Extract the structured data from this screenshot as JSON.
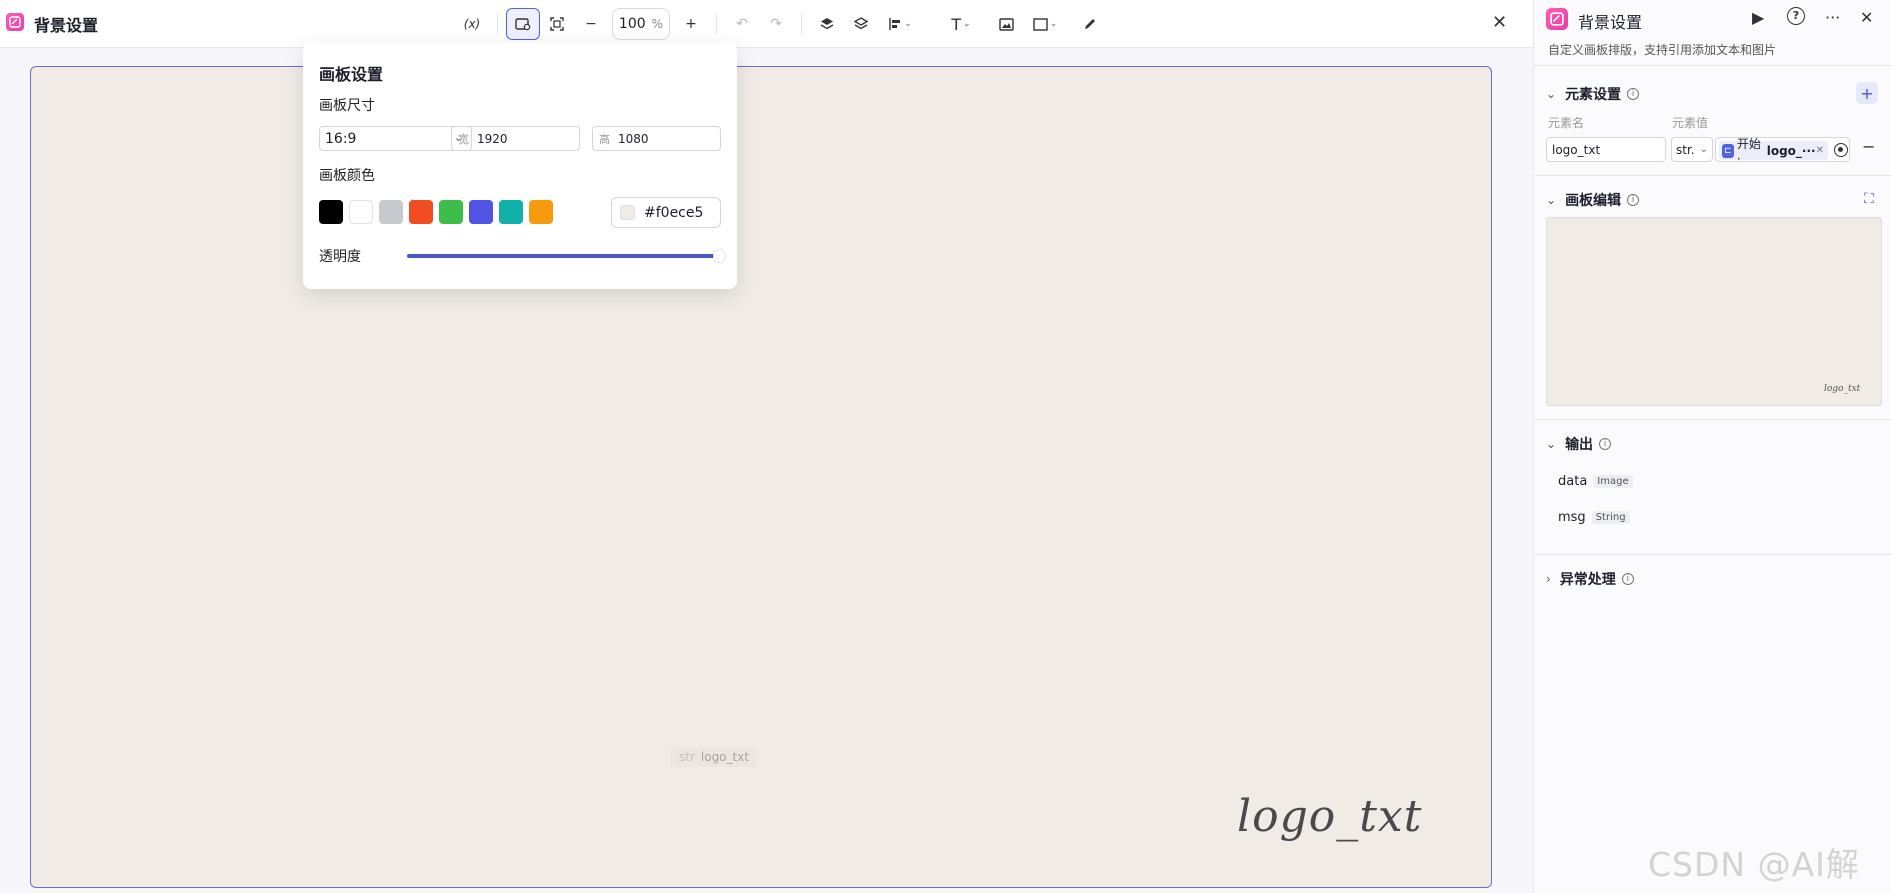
{
  "header": {
    "title": "背景设置",
    "variable_label": "(x)",
    "zoom_value": "100",
    "zoom_unit": "%",
    "close": "✕"
  },
  "canvas": {
    "background": "#f0ece5",
    "logo_text": "logo_txt",
    "element_tag_type": "str",
    "element_tag_name": "logo_txt"
  },
  "popover": {
    "title": "画板设置",
    "size_label": "画板尺寸",
    "ratio": "16:9",
    "width_prefix": "宽",
    "width": "1920",
    "height_prefix": "高",
    "height": "1080",
    "color_label": "画板颜色",
    "swatches": [
      "#000000",
      "#ffffff",
      "#c9c9d0",
      "#f04d23",
      "#3dbd4a",
      "#4f55e0",
      "#12b0aa",
      "#f79a10"
    ],
    "hex_value": "#f0ece5",
    "opacity_label": "透明度",
    "opacity": 1.0
  },
  "panel": {
    "title": "背景设置",
    "description": "自定义画板排版，支持引用添加文本和图片",
    "more": "···",
    "close": "✕",
    "elements_section": "元素设置",
    "col_name": "元素名",
    "col_value": "元素值",
    "element_name": "logo_txt",
    "element_type": "str.",
    "ref_source": "开始 ·",
    "ref_field": "logo_···",
    "canvas_section": "画板编辑",
    "preview_text": "logo_txt",
    "output_section": "输出",
    "outputs": [
      {
        "name": "data",
        "type": "Image"
      },
      {
        "name": "msg",
        "type": "String"
      }
    ],
    "error_section": "异常处理"
  },
  "watermark": "CSDN @AI解说"
}
